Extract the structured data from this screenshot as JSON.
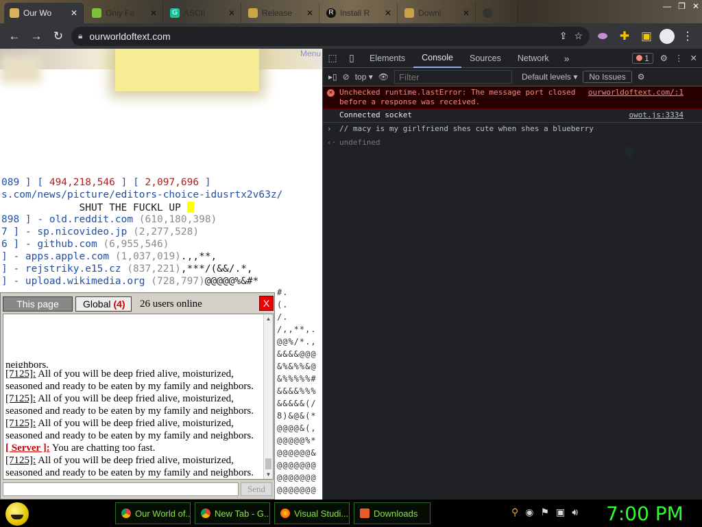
{
  "browser": {
    "tabs": [
      {
        "title": "Our Wo",
        "active": true
      },
      {
        "title": "Only Fa",
        "active": false
      },
      {
        "title": "ASCII",
        "active": false
      },
      {
        "title": "Release",
        "active": false
      },
      {
        "title": "Install R",
        "active": false
      },
      {
        "title": "Downl",
        "active": false
      },
      {
        "title": "",
        "active": false
      }
    ],
    "url": "ourworldoftext.com"
  },
  "page": {
    "menu_label": "Menu",
    "lines": [
      {
        "parts": [
          {
            "t": "089 ] [ ",
            "c": "blue"
          },
          {
            "t": "494,218,546",
            "c": "red"
          },
          {
            "t": " ] [ ",
            "c": "blue"
          },
          {
            "t": "2,097,696",
            "c": "red"
          },
          {
            "t": " ]",
            "c": "blue"
          }
        ]
      },
      {
        "parts": [
          {
            "t": "s.com/news/picture/editors-choice-idusrtx2v63z/",
            "c": "blue"
          }
        ]
      },
      {
        "parts": [
          {
            "t": "             SHUT THE FUCKL UP ",
            "c": ""
          }
        ]
      },
      {
        "parts": [
          {
            "t": "898 ] - old.reddit.com ",
            "c": "blue"
          },
          {
            "t": "(610,180,398)",
            "c": "gray"
          }
        ]
      },
      {
        "parts": [
          {
            "t": "7 ] - sp.nicovideo.jp ",
            "c": "blue"
          },
          {
            "t": "(2,277,528)",
            "c": "gray"
          }
        ]
      },
      {
        "parts": [
          {
            "t": "6 ] - github.com ",
            "c": "blue"
          },
          {
            "t": "(6,955,546)",
            "c": "gray"
          }
        ]
      },
      {
        "parts": [
          {
            "t": "] - apps.apple.com ",
            "c": "blue"
          },
          {
            "t": "(1,037,019)",
            "c": "gray"
          },
          {
            "t": ".,,**,",
            "c": ""
          }
        ]
      },
      {
        "parts": [
          {
            "t": "] - rejstriky.e15.cz ",
            "c": "blue"
          },
          {
            "t": "(837,221)",
            "c": "gray"
          },
          {
            "t": ",***/(&&/.*,",
            "c": ""
          }
        ]
      },
      {
        "parts": [
          {
            "t": "] - upload.wikimedia.org ",
            "c": "blue"
          },
          {
            "t": "(728,797)",
            "c": "gray"
          },
          {
            "t": "@@@@@%&#*",
            "c": ""
          }
        ]
      }
    ],
    "right_column": [
      "#.",
      "(.",
      "/.",
      "/,,**,.",
      "@@%/*.,",
      "&&&&@@@",
      "&%&%%&@",
      "&%%%%%#",
      "&&&&%%%",
      "&&&&&(/",
      "8)&@&(*",
      "@@@@&(,",
      "@@@@@%*",
      "@@@@@@&",
      "@@@@@@@",
      "@@@@@@@",
      "@@@@@@@"
    ]
  },
  "chat": {
    "tab_this_page": "This page",
    "tab_global": "Global",
    "global_count": "(4)",
    "online": "26 users online",
    "close": "X",
    "messages": [
      {
        "who": "[7125]:",
        "text": " All of you will be deep fried alive, moisturized, seasoned and ready to be eaten by my family and neighbors.",
        "server": false
      },
      {
        "who": "[7125]:",
        "text": " All of you will be deep fried alive, moisturized, seasoned and ready to be eaten by my family and neighbors.",
        "server": false
      },
      {
        "who": "[7125]:",
        "text": " All of you will be deep fried alive, moisturized, seasoned and ready to be eaten by my family and neighbors.",
        "server": false
      },
      {
        "who": "[ Server ]:",
        "text": " You are chatting too fast.",
        "server": true
      },
      {
        "who": "[7125]:",
        "text": " All of you will be deep fried alive, moisturized, seasoned and ready to be eaten by my family and neighbors.",
        "server": false
      }
    ],
    "top_fragment": "neighbors.",
    "input_value": "",
    "send": "Send"
  },
  "devtools": {
    "tabs": [
      "Elements",
      "Console",
      "Sources",
      "Network"
    ],
    "active_tab": "Console",
    "error_count": "1",
    "context": "top",
    "filter_placeholder": "Filter",
    "levels": "Default levels",
    "issues": "No Issues",
    "console": [
      {
        "type": "error",
        "text": "Unchecked runtime.lastError: The message port closed before a response was received.",
        "source": "ourworldoftext.com/:1"
      },
      {
        "type": "log",
        "text": "Connected socket",
        "source": "owot.js:3334"
      },
      {
        "type": "input",
        "text": "// macy is my girlfriend shes cute when shes a blueberry",
        "source": ""
      },
      {
        "type": "result",
        "text": "undefined",
        "source": ""
      }
    ]
  },
  "taskbar": {
    "items": [
      {
        "label": "Our World of...",
        "color": "#e0473a"
      },
      {
        "label": "New Tab - G...",
        "color": "#e0473a"
      },
      {
        "label": "Visual Studi...",
        "color": "#ff8a00"
      },
      {
        "label": "Downloads",
        "color": "#ff6a3a"
      }
    ],
    "clock": "7:00 PM"
  }
}
